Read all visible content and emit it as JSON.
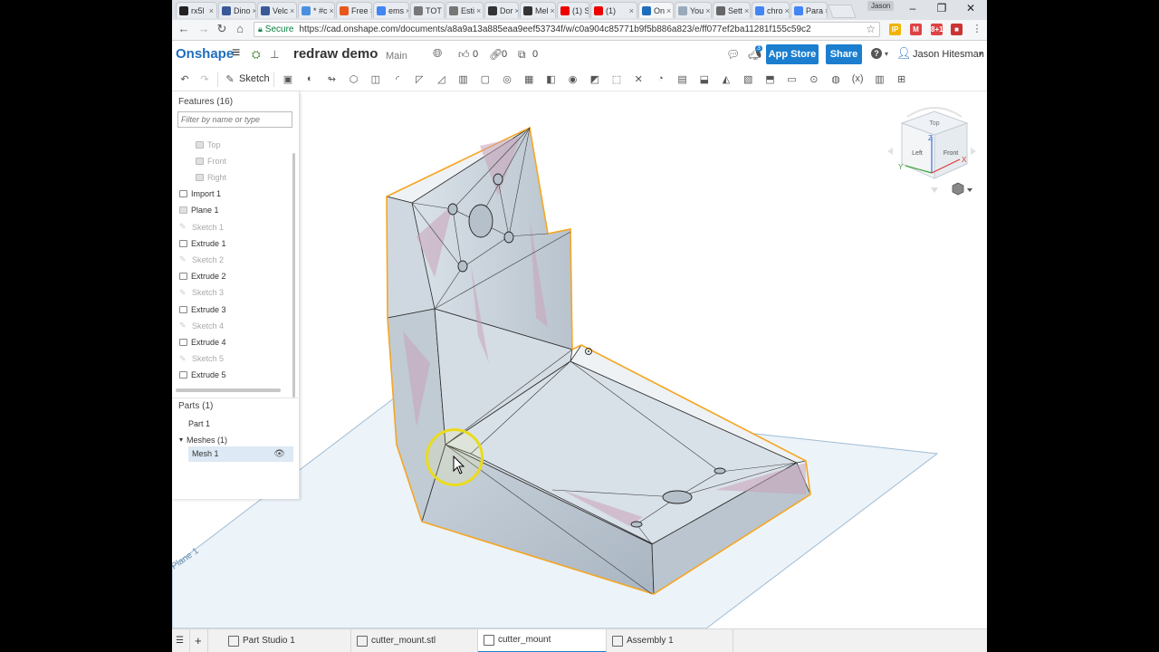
{
  "browser": {
    "tabs": [
      {
        "label": "rx5l",
        "color": "#222"
      },
      {
        "label": "Dino",
        "color": "#3b5998"
      },
      {
        "label": "Velc",
        "color": "#3b5998"
      },
      {
        "label": "* #c",
        "color": "#4a90e2"
      },
      {
        "label": "Free",
        "color": "#e8581c"
      },
      {
        "label": "ems",
        "color": "#4285f4"
      },
      {
        "label": "TOT",
        "color": "#777"
      },
      {
        "label": "Esti",
        "color": "#777"
      },
      {
        "label": "Dor",
        "color": "#333"
      },
      {
        "label": "Mel",
        "color": "#333"
      },
      {
        "label": "(1) S",
        "color": "#e00"
      },
      {
        "label": "(1)",
        "color": "#e00"
      },
      {
        "label": "On",
        "color": "#1f6ebd"
      },
      {
        "label": "You",
        "color": "#9ab"
      },
      {
        "label": "Sett",
        "color": "#666"
      },
      {
        "label": "chro",
        "color": "#4285f4"
      },
      {
        "label": "Para",
        "color": "#4285f4"
      }
    ],
    "profile": "Jason",
    "secure_label": "Secure",
    "url": "https://cad.onshape.com/documents/a8a9a13a885eaa9eef53734f/w/c0a904c85771b9f5b886a823/e/ff077ef2ba11281f155c59c2",
    "extensions": [
      {
        "label": "IP",
        "color": "#f0b400"
      },
      {
        "label": "M",
        "color": "#d44"
      },
      {
        "label": "8+1",
        "color": "#d44"
      },
      {
        "label": "■",
        "color": "#c33"
      }
    ]
  },
  "header": {
    "logo": "Onshape",
    "title": "redraw demo",
    "workspace": "Main",
    "likes": "0",
    "links": "0",
    "copies": "0",
    "notif_count": "3",
    "app_store": "App Store",
    "share": "Share",
    "help": "?",
    "user": "Jason Hitesman"
  },
  "toolbar": {
    "sketch_label": "Sketch"
  },
  "features": {
    "title": "Features (16)",
    "filter_placeholder": "Filter by name or type",
    "items": [
      {
        "label": "Top",
        "type": "plane",
        "dim": true,
        "indent": true
      },
      {
        "label": "Front",
        "type": "plane",
        "dim": true,
        "indent": true
      },
      {
        "label": "Right",
        "type": "plane",
        "dim": true,
        "indent": true
      },
      {
        "label": "Import 1",
        "type": "import",
        "dim": false,
        "indent": false
      },
      {
        "label": "Plane 1",
        "type": "plane",
        "dim": false,
        "indent": false
      },
      {
        "label": "Sketch 1",
        "type": "sketch",
        "dim": true,
        "indent": false
      },
      {
        "label": "Extrude 1",
        "type": "extrude",
        "dim": false,
        "indent": false
      },
      {
        "label": "Sketch 2",
        "type": "sketch",
        "dim": true,
        "indent": false
      },
      {
        "label": "Extrude 2",
        "type": "extrude",
        "dim": false,
        "indent": false
      },
      {
        "label": "Sketch 3",
        "type": "sketch",
        "dim": true,
        "indent": false
      },
      {
        "label": "Extrude 3",
        "type": "extrude",
        "dim": false,
        "indent": false
      },
      {
        "label": "Sketch 4",
        "type": "sketch",
        "dim": true,
        "indent": false
      },
      {
        "label": "Extrude 4",
        "type": "extrude",
        "dim": false,
        "indent": false
      },
      {
        "label": "Sketch 5",
        "type": "sketch",
        "dim": true,
        "indent": false
      },
      {
        "label": "Extrude 5",
        "type": "extrude",
        "dim": false,
        "indent": false
      }
    ]
  },
  "parts": {
    "title": "Parts (1)",
    "part": "Part 1",
    "meshes_title": "Meshes (1)",
    "mesh": "Mesh 1"
  },
  "viewcube": {
    "top": "Top",
    "left": "Left",
    "front": "Front",
    "axis_x": "X",
    "axis_y": "Y",
    "axis_z": "Z"
  },
  "viewport": {
    "plane_label": "Plane 1"
  },
  "bottom_tabs": [
    {
      "label": "Part Studio 1",
      "active": false
    },
    {
      "label": "cutter_mount.stl",
      "active": false
    },
    {
      "label": "cutter_mount",
      "active": true
    },
    {
      "label": "Assembly 1",
      "active": false
    }
  ]
}
